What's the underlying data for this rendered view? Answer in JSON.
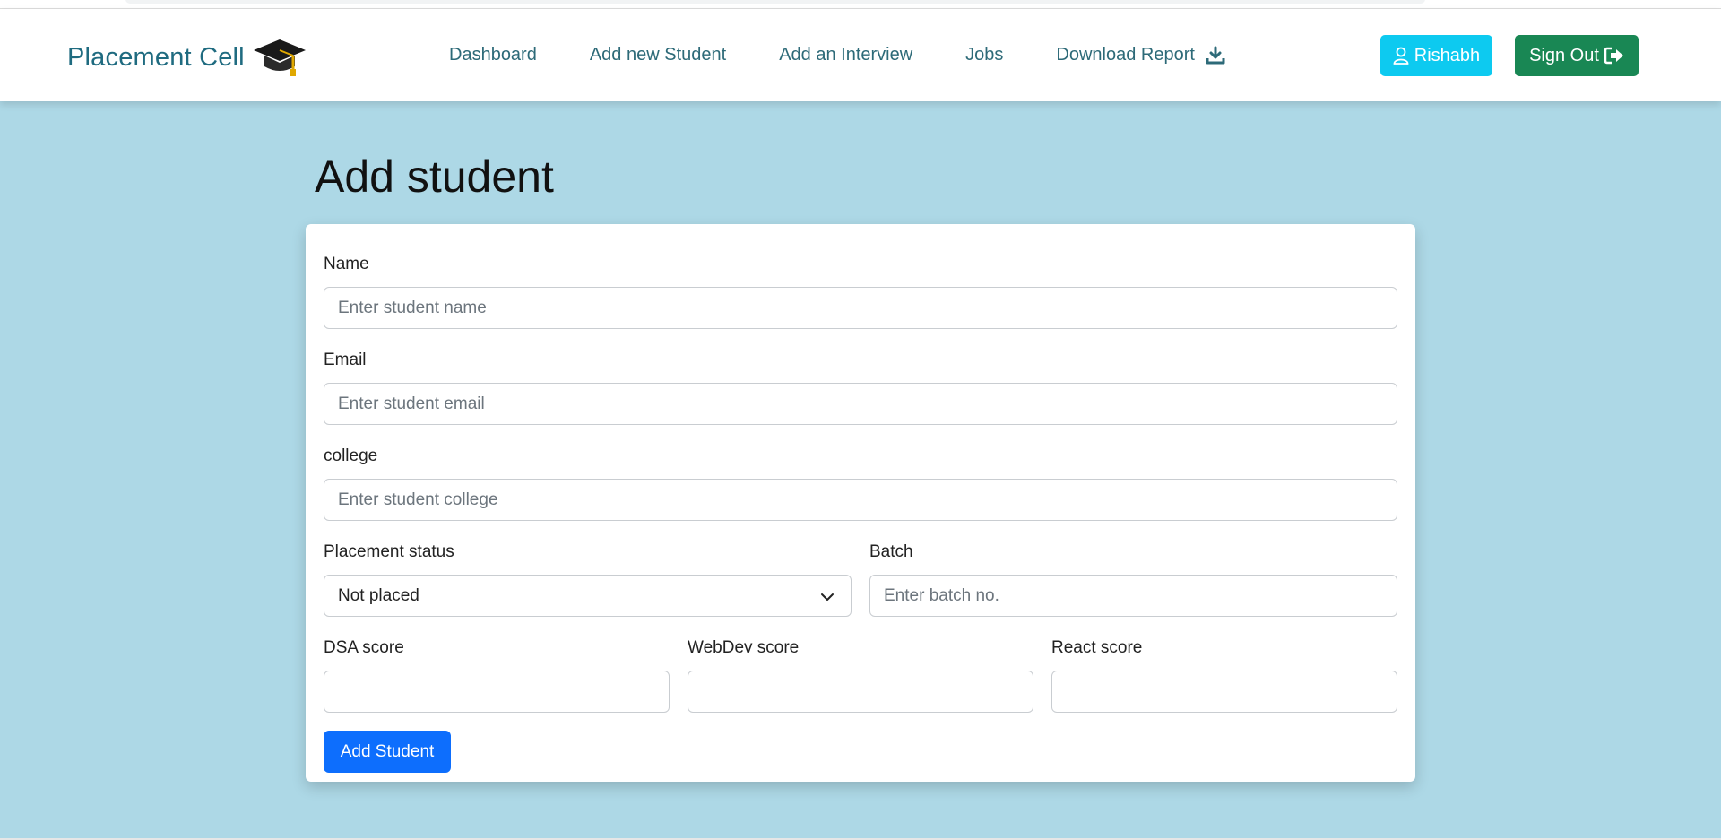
{
  "brand": {
    "title": "Placement Cell",
    "icon": "graduation-cap-icon"
  },
  "nav": {
    "items": [
      {
        "label": "Dashboard"
      },
      {
        "label": "Add new Student"
      },
      {
        "label": "Add an Interview"
      },
      {
        "label": "Jobs"
      },
      {
        "label": "Download Report",
        "icon": "download-icon"
      }
    ]
  },
  "user_button": {
    "label": "Rishabh",
    "icon": "user-icon",
    "color": "#0dcaf0"
  },
  "signout_button": {
    "label": "Sign Out",
    "icon": "sign-out-icon",
    "color": "#198754"
  },
  "page": {
    "title": "Add student",
    "background": "#add8e6"
  },
  "form": {
    "name": {
      "label": "Name",
      "placeholder": "Enter student name"
    },
    "email": {
      "label": "Email",
      "placeholder": "Enter student email"
    },
    "college": {
      "label": "college",
      "placeholder": "Enter student college"
    },
    "placement_status": {
      "label": "Placement status",
      "value": "Not placed"
    },
    "batch": {
      "label": "Batch",
      "placeholder": "Enter batch no."
    },
    "dsa": {
      "label": "DSA score",
      "value": ""
    },
    "webdev": {
      "label": "WebDev score",
      "value": ""
    },
    "react": {
      "label": "React score",
      "value": ""
    },
    "submit_label": "Add Student",
    "submit_color": "#0d6efd"
  }
}
